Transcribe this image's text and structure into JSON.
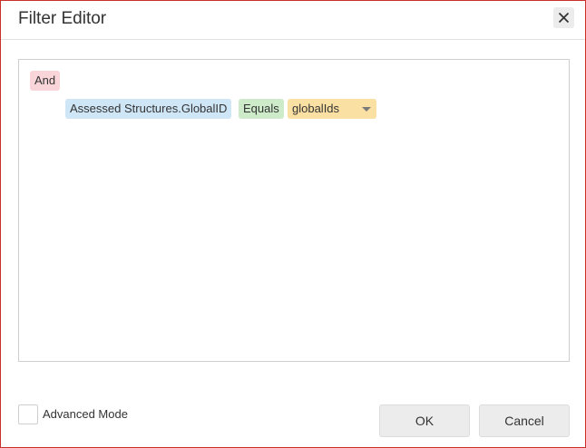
{
  "dialog": {
    "title": "Filter Editor",
    "close_icon": "close-icon"
  },
  "filter": {
    "group_operator": "And",
    "condition": {
      "field": "Assessed Structures.GlobalID",
      "operator": "Equals",
      "value": "globalIds",
      "value_dropdown_icon": "chevron-down-icon"
    }
  },
  "footer": {
    "advanced_mode_label": "Advanced Mode",
    "advanced_mode_checked": false,
    "ok_label": "OK",
    "cancel_label": "Cancel"
  },
  "colors": {
    "dialog_border": "#c9302c",
    "group_chip": "#f9d5d9",
    "field_chip": "#cfe6f7",
    "operator_chip": "#cdebc9",
    "value_chip": "#fbe0a3"
  }
}
